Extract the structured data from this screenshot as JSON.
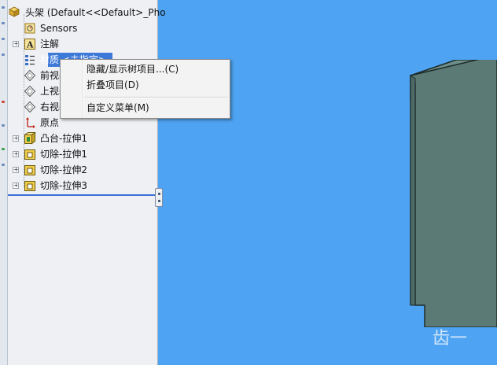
{
  "colors": {
    "viewport_bg": "#4ea3f2",
    "tree_bg": "#eef0f4",
    "selection": "#3d79d9",
    "model_face": "#5b7a76",
    "model_top": "#6d8e89"
  },
  "tree": {
    "root": {
      "label": "头架  (Default<<Default>_Pho",
      "icon": "part-icon"
    },
    "items": [
      {
        "label": "Sensors",
        "icon": "sensors-icon",
        "expandable": false
      },
      {
        "label": "注解",
        "icon": "annotations-icon",
        "expandable": true
      },
      {
        "label": "材质 <未指定>",
        "icon": "material-icon",
        "expandable": false,
        "selected": true
      },
      {
        "label": "前视基准面",
        "icon": "plane-icon",
        "expandable": false
      },
      {
        "label": "上视基准面",
        "icon": "plane-icon",
        "expandable": false
      },
      {
        "label": "右视基准面",
        "icon": "plane-icon",
        "expandable": false
      },
      {
        "label": "原点",
        "icon": "origin-icon",
        "expandable": false
      },
      {
        "label": "凸台-拉伸1",
        "icon": "boss-extrude-icon",
        "expandable": true
      },
      {
        "label": "切除-拉伸1",
        "icon": "cut-extrude-icon",
        "expandable": true
      },
      {
        "label": "切除-拉伸2",
        "icon": "cut-extrude-icon",
        "expandable": true
      },
      {
        "label": "切除-拉伸3",
        "icon": "cut-extrude-icon",
        "expandable": true
      }
    ]
  },
  "context_menu": {
    "items": [
      {
        "label": "隐藏/显示树项目...",
        "shortcut": "(C)",
        "key": "C"
      },
      {
        "label": "折叠项目",
        "shortcut": "(D)",
        "key": "D"
      },
      {
        "label": "自定义菜单",
        "shortcut": "(M)",
        "key": "M"
      }
    ]
  },
  "watermark": {
    "text": "齿一"
  }
}
